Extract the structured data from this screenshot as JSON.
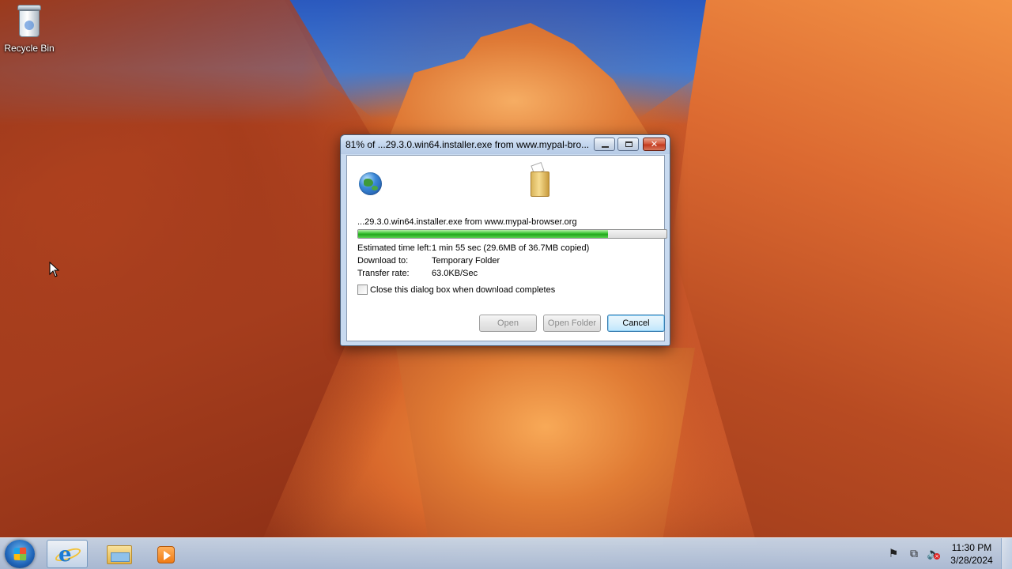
{
  "desktop": {
    "icons": [
      {
        "label": "Recycle Bin",
        "icon": "recycle-bin-icon"
      }
    ]
  },
  "dialog": {
    "title": "81% of ...29.3.0.win64.installer.exe from www.mypal-bro...",
    "filename": "...29.3.0.win64.installer.exe from www.mypal-browser.org",
    "progress": 0.81,
    "info": [
      {
        "label": "Estimated time left:",
        "value": "1 min 55 sec (29.6MB of 36.7MB copied)"
      },
      {
        "label": "Download to:",
        "value": "Temporary Folder"
      },
      {
        "label": "Transfer rate:",
        "value": "63.0KB/Sec"
      }
    ],
    "checkbox_label": "Close this dialog box when download completes",
    "checkbox_checked": false,
    "buttons": {
      "open": "Open",
      "open_folder": "Open Folder",
      "cancel": "Cancel"
    },
    "window_controls": {
      "close_glyph": "✕"
    }
  },
  "taskbar": {
    "items": [
      "start-button",
      "internet-explorer-icon",
      "windows-explorer-icon",
      "media-player-icon"
    ],
    "clock": {
      "time": "11:30 PM",
      "date": "3/28/2024"
    },
    "tray": {
      "flag_glyph": "⚑",
      "network_glyph": "⧉",
      "volume_glyph": "🔈",
      "volume_mute_glyph": "×"
    },
    "ie_glyph": "e"
  },
  "colors": {
    "progress_green": "#37c130",
    "cancel_border": "#3c7fb1",
    "titlebar": "#c3d6ee"
  }
}
